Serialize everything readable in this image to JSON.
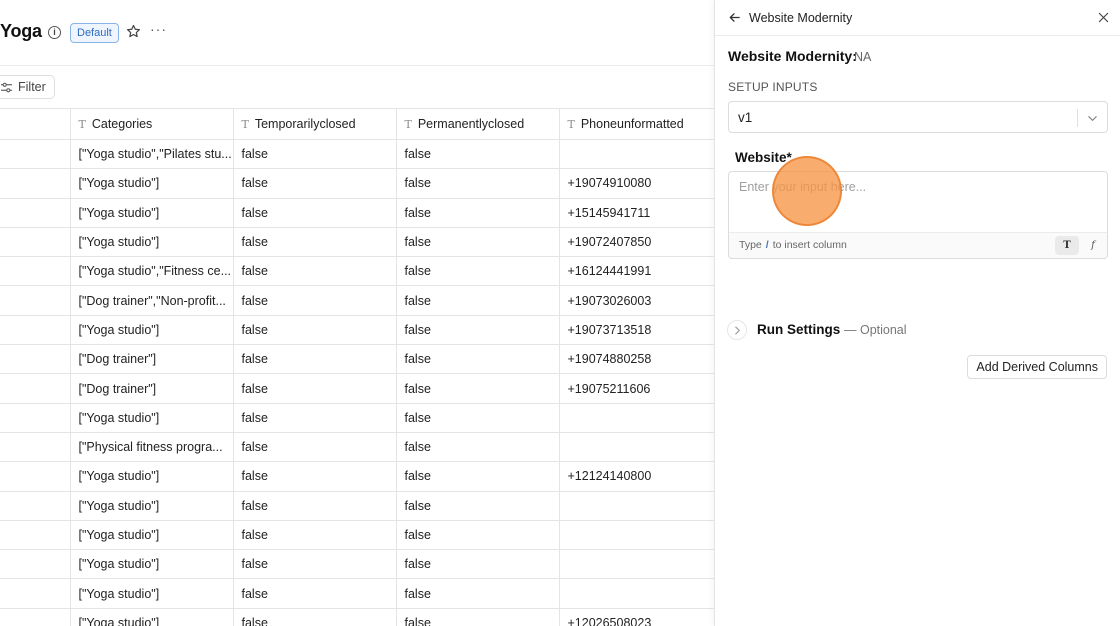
{
  "view": {
    "title": "Yoga",
    "badge": "Default",
    "more": "···",
    "filter_label": "Filter"
  },
  "table": {
    "columns": [
      "",
      "Categories",
      "Temporarilyclosed",
      "Permanentlyclosed",
      "Phoneunformatted"
    ],
    "rows": [
      [
        "",
        "[\"Yoga studio\",\"Pilates stu...",
        "false",
        "false",
        ""
      ],
      [
        "",
        "[\"Yoga studio\"]",
        "false",
        "false",
        "+19074910080"
      ],
      [
        "",
        "[\"Yoga studio\"]",
        "false",
        "false",
        "+15145941711"
      ],
      [
        "",
        "[\"Yoga studio\"]",
        "false",
        "false",
        "+19072407850"
      ],
      [
        "",
        "[\"Yoga studio\",\"Fitness ce...",
        "false",
        "false",
        "+16124441991"
      ],
      [
        "",
        "[\"Dog trainer\",\"Non-profit...",
        "false",
        "false",
        "+19073026003"
      ],
      [
        "",
        "[\"Yoga studio\"]",
        "false",
        "false",
        "+19073713518"
      ],
      [
        "",
        "[\"Dog trainer\"]",
        "false",
        "false",
        "+19074880258"
      ],
      [
        "",
        "[\"Dog trainer\"]",
        "false",
        "false",
        "+19075211606"
      ],
      [
        "",
        "[\"Yoga studio\"]",
        "false",
        "false",
        ""
      ],
      [
        "",
        "[\"Physical fitness progra...",
        "false",
        "false",
        ""
      ],
      [
        "",
        "[\"Yoga studio\"]",
        "false",
        "false",
        "+12124140800"
      ],
      [
        "",
        "[\"Yoga studio\"]",
        "false",
        "false",
        ""
      ],
      [
        "",
        "[\"Yoga studio\"]",
        "false",
        "false",
        ""
      ],
      [
        "",
        "[\"Yoga studio\"]",
        "false",
        "false",
        ""
      ],
      [
        "",
        "[\"Yoga studio\"]",
        "false",
        "false",
        ""
      ],
      [
        "",
        "[\"Yoga studio\"]",
        "false",
        "false",
        "+12026508023"
      ]
    ]
  },
  "panel": {
    "title": "Website Modernity",
    "heading": "Website Modernity:",
    "heading_value": "NA",
    "setup_label": "SETUP INPUTS",
    "version": "v1",
    "field_label": "Website*",
    "input_placeholder": "Enter your input here...",
    "input_value": "",
    "hint_prefix": "Type",
    "hint_slash": "/",
    "hint_suffix": "to insert column",
    "mode_text": "T",
    "mode_formula": "f",
    "run_settings": "Run Settings",
    "run_optional": "— Optional",
    "derived_button": "Add Derived Columns"
  },
  "colors": {
    "accent_blue": "#2d6cc0",
    "cursor_orange": "#f69646"
  }
}
